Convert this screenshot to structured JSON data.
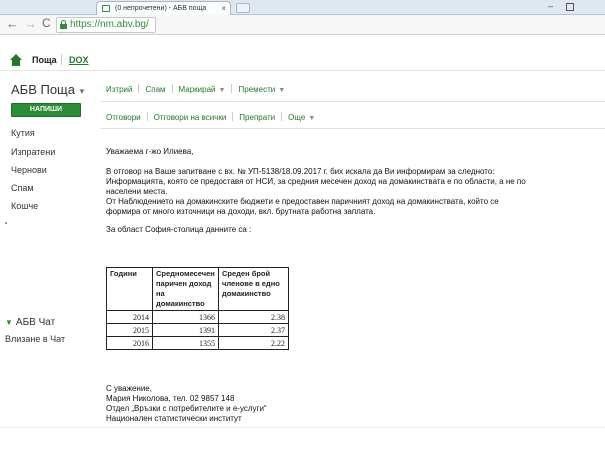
{
  "browser": {
    "tab_title": "(0 непрочетени) - АБВ поща",
    "tab_close": "×",
    "url_host": "https://nm.abv.bg/",
    "url_rest": "",
    "back": "←",
    "forward": "→",
    "reload": "C",
    "minimize": "–"
  },
  "app_header": {
    "poshta": "Поща",
    "dox": "DOX"
  },
  "sidebar": {
    "brand": "АБВ Поща",
    "brand_caret": "▼",
    "compose_label": "НАПИШИ",
    "folders": [
      "Кутия",
      "Изпратени",
      "Чернови",
      "Спам",
      "Кошче"
    ],
    "chat_title": "АБВ Чат",
    "chat_login": "Влизане в Чат"
  },
  "actions_top": {
    "delete": "Изтрий",
    "spam": "Спам",
    "mark": "Маркирай",
    "move": "Премести"
  },
  "actions_bottom": {
    "reply": "Отговори",
    "reply_all": "Отговори на всички",
    "forward": "Препрати",
    "more": "Още"
  },
  "letter": {
    "greeting": "Уважаема г-жо Илиева,",
    "p1": "В отговор на Ваше запитване с вх. № УП-5138/18.09.2017 г. бих искала да Ви информирам за следното:",
    "p2": "Информацията, която се предоставя от НСИ, за средния месечен доход на домакинствата е по области, а не по населени места.",
    "p3": "От Наблюдението на домакинските бюджети е предоставен паричният доход на домакинствата, който се формира от много източници на доходи, вкл. брутната работна заплата.",
    "region_line": "За област София-столица данните са :",
    "table": {
      "headers": [
        "Години",
        "Средномесечен паричен доход на домакинство",
        "Среден брой членове в едно домакинство"
      ],
      "rows": [
        [
          "2014",
          "1366",
          "2.38"
        ],
        [
          "2015",
          "1391",
          "2.37"
        ],
        [
          "2016",
          "1355",
          "2.22"
        ]
      ]
    },
    "closing": "С уважение,",
    "signer": "Мария Николова, тел. 02 9857 148",
    "department": "Отдел „Връзки с потребителите и е-услуги“",
    "institution": "Национален статистически институт"
  }
}
